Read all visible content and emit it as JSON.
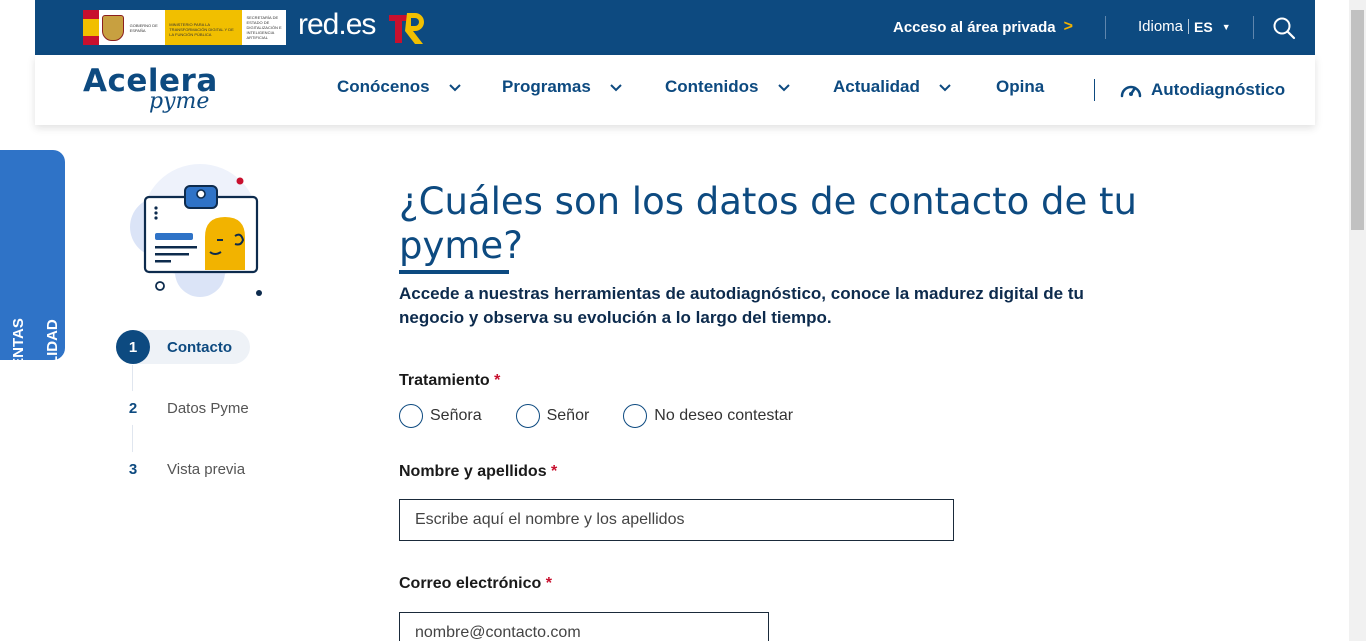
{
  "topbar": {
    "gov_logo_text": "GOBIERNO DE ESPAÑA",
    "ministry_text": "MINISTERIO PARA LA TRANSFORMACIÓN DIGITAL Y DE LA FUNCIÓN PÚBLICA",
    "secretary_text": "SECRETARÍA DE ESTADO DE DIGITALIZACIÓN E INTELIGENCIA ARTIFICIAL",
    "redes_logo": "red.es",
    "private_area": "Acceso al área privada",
    "private_area_chevron": ">",
    "language_label": "Idioma",
    "language_value": "ES",
    "icons": [
      "chevron-right-icon",
      "caret-down-icon",
      "search-icon"
    ]
  },
  "nav": {
    "logo_main": "Acelera",
    "logo_sub": "pyme",
    "items": [
      {
        "label": "Conócenos",
        "dropdown": true
      },
      {
        "label": "Programas",
        "dropdown": true
      },
      {
        "label": "Contenidos",
        "dropdown": true
      },
      {
        "label": "Actualidad",
        "dropdown": true
      },
      {
        "label": "Opina",
        "dropdown": false
      }
    ],
    "autodiag": "Autodiagnóstico"
  },
  "accessibility": {
    "label": "HERRAMIENTAS DE ACCESIBILIDAD"
  },
  "steps": [
    {
      "number": "1",
      "label": "Contacto",
      "active": true
    },
    {
      "number": "2",
      "label": "Datos Pyme",
      "active": false
    },
    {
      "number": "3",
      "label": "Vista previa",
      "active": false
    }
  ],
  "form": {
    "title": "¿Cuáles son los datos de contacto de tu pyme?",
    "subtitle": "Accede a nuestras herramientas de autodiagnóstico, conoce la madurez digital de tu negocio y observa su evolución a lo largo del tiempo.",
    "required_mark": "*",
    "tratamiento": {
      "label": "Tratamiento",
      "options": [
        "Señora",
        "Señor",
        "No deseo contestar"
      ]
    },
    "nombre": {
      "label": "Nombre y apellidos",
      "placeholder": "Escribe aquí el nombre y los apellidos"
    },
    "correo": {
      "label": "Correo electrónico",
      "placeholder": "nombre@contacto.com"
    }
  },
  "colors": {
    "primary": "#0d4a80",
    "accent_yellow": "#f2b300",
    "required_red": "#c8102e",
    "accessibility_blue": "#2f73c7"
  }
}
